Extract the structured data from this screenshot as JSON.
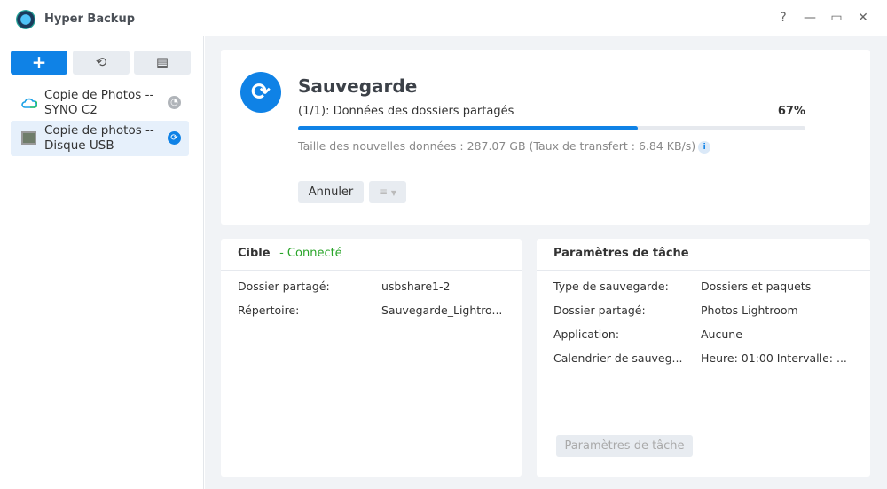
{
  "app": {
    "title": "Hyper Backup"
  },
  "window_controls": {
    "help": "?",
    "minimize": "—",
    "maximize": "▭",
    "close": "✕"
  },
  "toolbar": {
    "add": "+",
    "history": "⟲",
    "log": "▤"
  },
  "tasks": [
    {
      "label_line1": "Copie de Photos --",
      "label_line2": "SYNO C2",
      "status": "scheduled",
      "selected": false
    },
    {
      "label_line1": "Copie de photos --",
      "label_line2": "Disque USB",
      "status": "running",
      "selected": true
    }
  ],
  "status": {
    "title": "Sauvegarde",
    "step": "(1/1): Données des dossiers partagés",
    "progress_label": "67%",
    "progress": 67,
    "info": "Taille des nouvelles données : 287.07 GB (Taux de transfert : 6.84 KB/s)",
    "info_icon": "i",
    "cancel_label": "Annuler"
  },
  "target": {
    "title": "Cible",
    "state": "- Connecté",
    "state_color": "#2aa52a",
    "rows": [
      {
        "label": "Dossier partagé:",
        "value": "usbshare1-2"
      },
      {
        "label": "Répertoire:",
        "value": "Sauvegarde_Lightro..."
      }
    ]
  },
  "params": {
    "title": "Paramètres de tâche",
    "rows": [
      {
        "label": "Type de sauvegarde:",
        "value": "Dossiers et paquets"
      },
      {
        "label": "Dossier partagé:",
        "value": "Photos Lightroom"
      },
      {
        "label": "Application:",
        "value": "Aucune"
      },
      {
        "label": "Calendrier de sauveg...",
        "value": "Heure: 01:00 Intervalle: ..."
      }
    ],
    "button_label": "Paramètres de tâche"
  }
}
